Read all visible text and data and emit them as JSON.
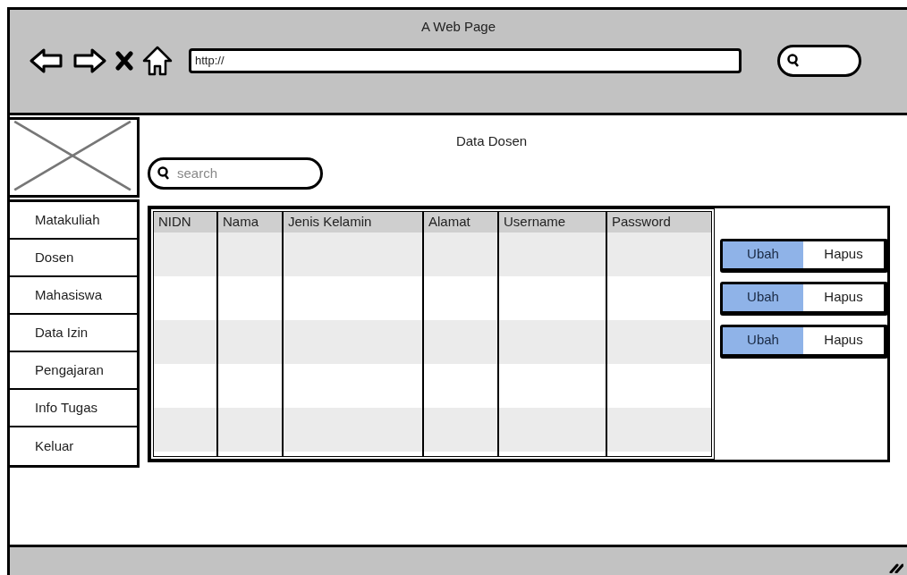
{
  "window": {
    "title": "A Web Page"
  },
  "address_bar": {
    "value": "http://"
  },
  "page": {
    "title": "Data Dosen"
  },
  "search": {
    "placeholder": "search"
  },
  "sidebar": {
    "items": [
      {
        "label": "Matakuliah"
      },
      {
        "label": "Dosen"
      },
      {
        "label": "Mahasiswa"
      },
      {
        "label": "Data Izin"
      },
      {
        "label": "Pengajaran"
      },
      {
        "label": "Info Tugas"
      },
      {
        "label": "Keluar"
      }
    ]
  },
  "table": {
    "columns": [
      "NIDN",
      "Nama",
      "Jenis Kelamin",
      "Alamat",
      "Username",
      "Password"
    ]
  },
  "actions": [
    {
      "buttons": [
        {
          "label": "Ubah",
          "selected": true
        },
        {
          "label": "Hapus",
          "selected": false
        }
      ]
    },
    {
      "buttons": [
        {
          "label": "Ubah",
          "selected": true
        },
        {
          "label": "Hapus",
          "selected": false
        }
      ]
    },
    {
      "buttons": [
        {
          "label": "Ubah",
          "selected": true
        },
        {
          "label": "Hapus",
          "selected": false
        }
      ]
    }
  ]
}
